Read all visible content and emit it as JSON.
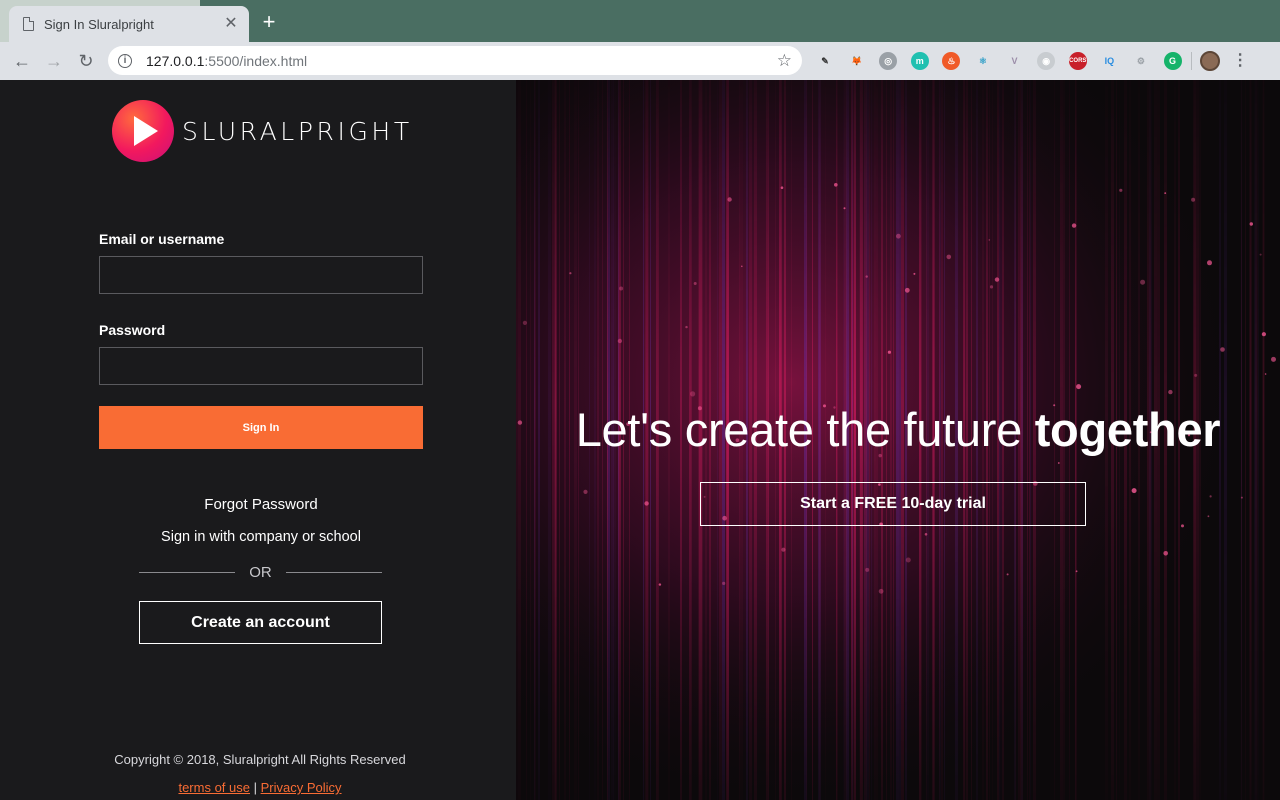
{
  "browser": {
    "tab_title": "Sign In Sluralpright",
    "tab_close": "✕",
    "new_tab": "+",
    "back": "←",
    "forward": "→",
    "reload": "↻",
    "url_host": "127.0.0.1",
    "url_path": ":5500/index.html",
    "bookmark": "☆",
    "menu": "⋮",
    "extensions": [
      {
        "name": "eyedropper-icon",
        "glyph": "✎",
        "bg": "#dee1e6",
        "fg": "#333"
      },
      {
        "name": "metamask-fox-icon",
        "glyph": "🦊",
        "bg": "#dee1e6",
        "fg": "#e2761b"
      },
      {
        "name": "ring-extension-icon",
        "glyph": "◎",
        "bg": "#9aa0a6",
        "fg": "#fff"
      },
      {
        "name": "m-extension-icon",
        "glyph": "m",
        "bg": "#20c0b0",
        "fg": "#fff"
      },
      {
        "name": "flame-extension-icon",
        "glyph": "♨",
        "bg": "#f05a28",
        "fg": "#fff"
      },
      {
        "name": "react-devtools-icon",
        "glyph": "⚛",
        "bg": "#dee1e6",
        "fg": "#34a0c8"
      },
      {
        "name": "vue-devtools-icon",
        "glyph": "V",
        "bg": "#dee1e6",
        "fg": "#9b8ca8"
      },
      {
        "name": "circle-extension-icon",
        "glyph": "◉",
        "bg": "#c8ccd0",
        "fg": "#fff"
      },
      {
        "name": "cors-extension-icon",
        "glyph": "CORS",
        "bg": "#c8202a",
        "fg": "#fff"
      },
      {
        "name": "iq-extension-icon",
        "glyph": "IQ",
        "bg": "#dee1e6",
        "fg": "#2a8de0"
      },
      {
        "name": "gear-extension-icon",
        "glyph": "⚙",
        "bg": "#dee1e6",
        "fg": "#9aa0a6"
      },
      {
        "name": "grammarly-icon",
        "glyph": "G",
        "bg": "#15b36a",
        "fg": "#fff"
      }
    ],
    "accent": "#4a6e62"
  },
  "brand": {
    "name": "SLURALPRIGHT",
    "accent": "#f96c34"
  },
  "form": {
    "email_label": "Email or username",
    "email_value": "",
    "password_label": "Password",
    "password_value": "",
    "signin_label": "Sign In",
    "forgot_label": "Forgot Password",
    "company_label": "Sign in with company or school",
    "or_label": "OR",
    "create_label": "Create an account"
  },
  "footer": {
    "copyright": "Copyright © 2018, Sluralpright All Rights Reserved",
    "terms": "terms of use",
    "separator": " | ",
    "privacy": "Privacy Policy"
  },
  "hero": {
    "headline": "Let's create the future ",
    "headline_bold": "together",
    "cta_label": "Start a FREE 10-day trial"
  }
}
